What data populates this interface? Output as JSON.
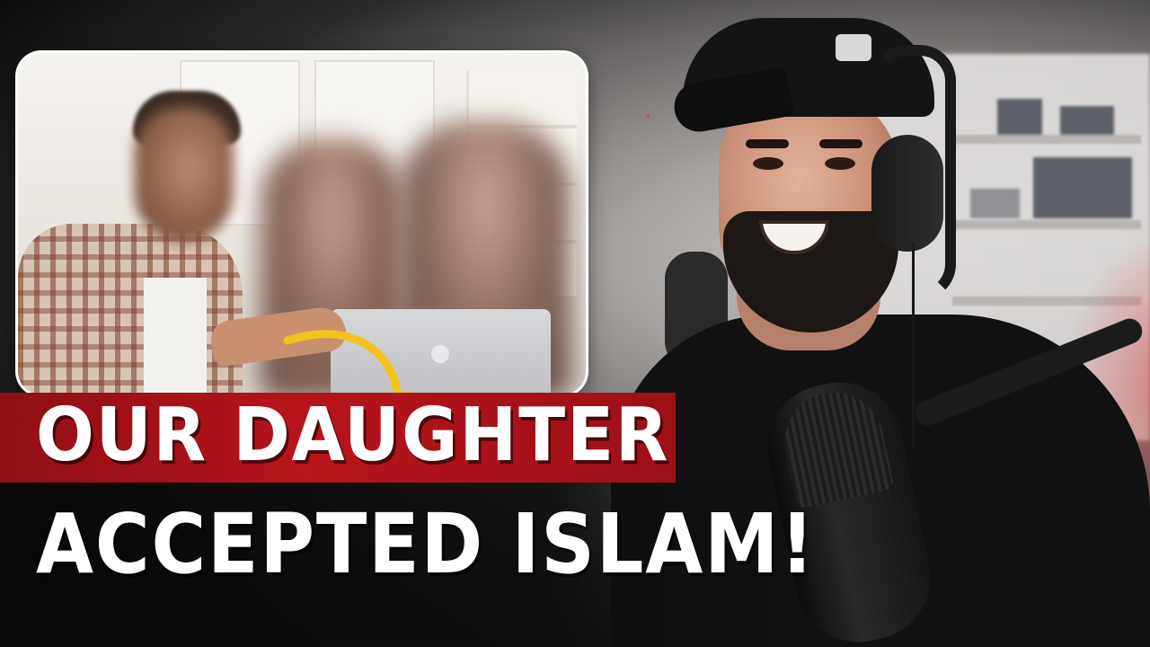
{
  "headline": {
    "line1": "OUR DAUGHTER",
    "line2": "ACCEPTED ISLAM!"
  },
  "colors": {
    "banner_red": "#b7141b",
    "arrow_yellow": "#f2c31b",
    "text": "#ffffff"
  },
  "icons": {
    "arrow": "curved-arrow-icon"
  }
}
